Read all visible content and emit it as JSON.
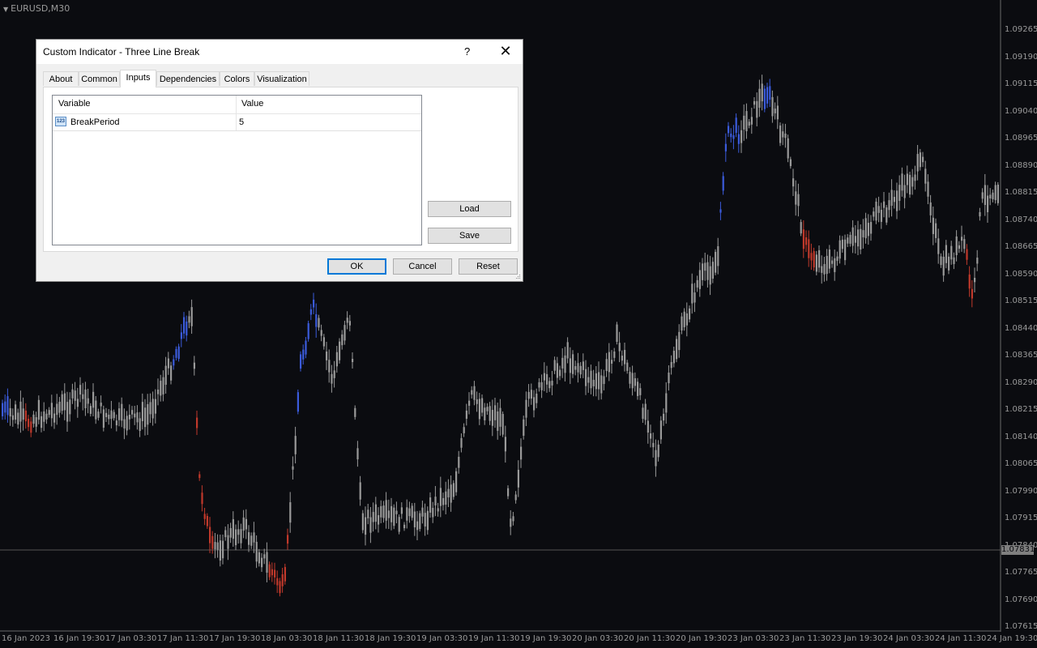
{
  "chart_header": {
    "symbol": "EURUSD,M30"
  },
  "price_axis": {
    "labels": [
      "1.09265",
      "1.09190",
      "1.09115",
      "1.09040",
      "1.08965",
      "1.08890",
      "1.08815",
      "1.08740",
      "1.08665",
      "1.08590",
      "1.08515",
      "1.08440",
      "1.08365",
      "1.08290",
      "1.08215",
      "1.08140",
      "1.08065",
      "1.07990",
      "1.07915",
      "1.07840",
      "1.07765",
      "1.07690",
      "1.07615"
    ],
    "current_price": "1.07831"
  },
  "time_axis": {
    "labels": [
      "16 Jan 2023",
      "16 Jan 19:30",
      "17 Jan 03:30",
      "17 Jan 11:30",
      "17 Jan 19:30",
      "18 Jan 03:30",
      "18 Jan 11:30",
      "18 Jan 19:30",
      "19 Jan 03:30",
      "19 Jan 11:30",
      "19 Jan 19:30",
      "20 Jan 03:30",
      "20 Jan 11:30",
      "20 Jan 19:30",
      "23 Jan 03:30",
      "23 Jan 11:30",
      "23 Jan 19:30",
      "24 Jan 03:30",
      "24 Jan 11:30",
      "24 Jan 19:30"
    ]
  },
  "colors": {
    "candle_neutral": "#9a9a9a",
    "candle_up": "#3b5bdb",
    "candle_down": "#c0392b",
    "background": "#0b0c10"
  },
  "dialog": {
    "title": "Custom Indicator - Three Line Break",
    "help_label": "?",
    "close_icon": "close-icon",
    "tabs": [
      "About",
      "Common",
      "Inputs",
      "Dependencies",
      "Colors",
      "Visualization"
    ],
    "active_tab": "Inputs",
    "grid": {
      "columns": [
        "Variable",
        "Value"
      ],
      "rows": [
        {
          "icon": "int-type-icon",
          "icon_text": "123",
          "variable": "BreakPeriod",
          "value": "5"
        }
      ]
    },
    "buttons": {
      "load": "Load",
      "save": "Save",
      "ok": "OK",
      "cancel": "Cancel",
      "reset": "Reset"
    }
  }
}
